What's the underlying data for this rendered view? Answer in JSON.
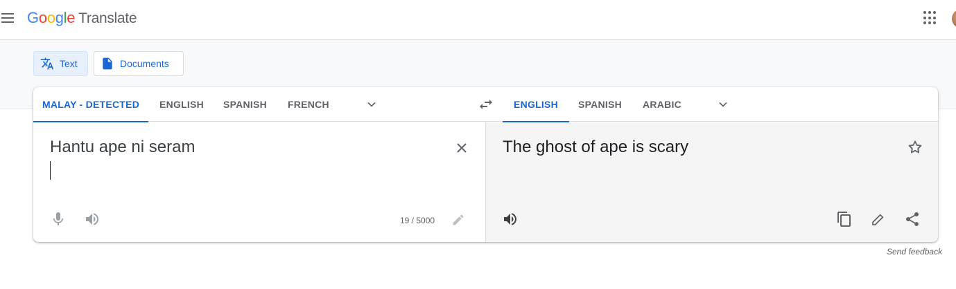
{
  "header": {
    "logo_letters": [
      "G",
      "o",
      "o",
      "g",
      "l",
      "e"
    ],
    "logo_colors": [
      "#4285F4",
      "#EA4335",
      "#FBBC05",
      "#4285F4",
      "#34A853",
      "#EA4335"
    ],
    "product_name": "Translate"
  },
  "modes": [
    {
      "label": "Text",
      "icon": "translate-icon",
      "active": true
    },
    {
      "label": "Documents",
      "icon": "document-icon",
      "active": false
    }
  ],
  "source": {
    "languages": [
      "MALAY - DETECTED",
      "ENGLISH",
      "SPANISH",
      "FRENCH"
    ],
    "selected": "MALAY - DETECTED",
    "text": "Hantu ape ni seram",
    "char_count": "19 / 5000"
  },
  "target": {
    "languages": [
      "ENGLISH",
      "SPANISH",
      "ARABIC"
    ],
    "selected": "ENGLISH",
    "text": "The ghost of ape is scary"
  },
  "feedback_label": "Send feedback",
  "colors": {
    "accent": "#1967d2",
    "icon_grey": "#5f6368",
    "target_bg": "#f5f5f5"
  }
}
